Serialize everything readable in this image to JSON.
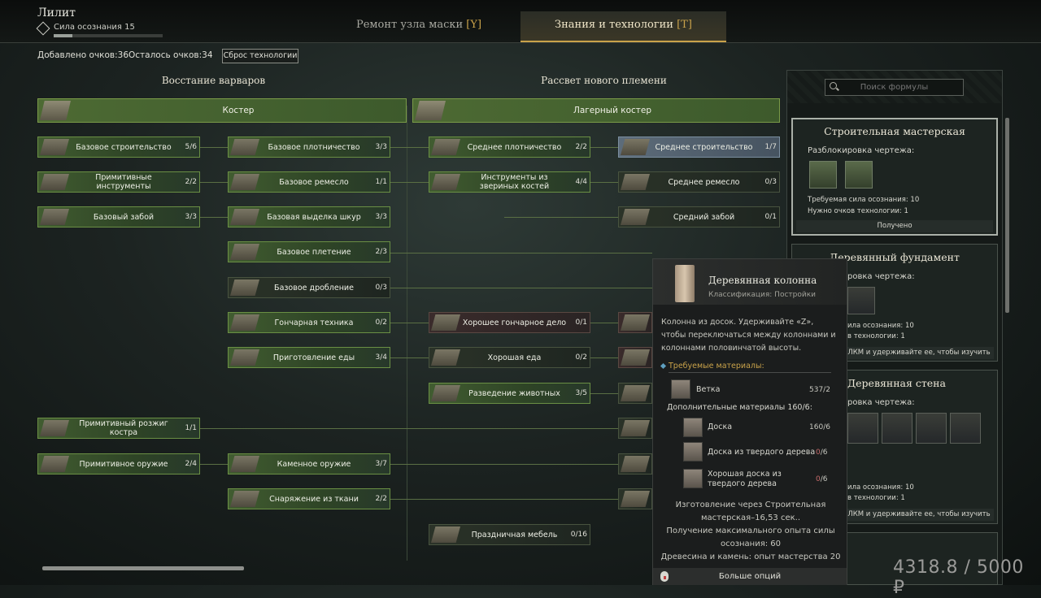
{
  "player": {
    "name": "Лилит",
    "awareness": "Сила осознания 15",
    "awareness_progress": 0.17
  },
  "tabs": [
    {
      "label": "Ремонт узла маски",
      "key": "[Y]",
      "active": false
    },
    {
      "label": "Знания и технологии",
      "key": "[T]",
      "active": true
    }
  ],
  "points": {
    "added": "Добавлено очков:36",
    "left": "Осталось очков:34",
    "reset": "Сброс технологии"
  },
  "columns": {
    "left": "Восстание варваров",
    "right": "Рассвет нового племени"
  },
  "headers": {
    "left": "Костер",
    "right": "Лагерный костер"
  },
  "nodes": [
    {
      "label": "Базовое строительство",
      "count": "5/6"
    },
    {
      "label": "Примитивные инструменты",
      "count": "2/2"
    },
    {
      "label": "Базовый забой",
      "count": "3/3"
    },
    {
      "label": "Базовое плотничество",
      "count": "3/3"
    },
    {
      "label": "Базовое ремесло",
      "count": "1/1"
    },
    {
      "label": "Базовая выделка шкур",
      "count": "3/3"
    },
    {
      "label": "Базовое плетение",
      "count": "2/3"
    },
    {
      "label": "Базовое дробление",
      "count": "0/3"
    },
    {
      "label": "Гончарная техника",
      "count": "0/2"
    },
    {
      "label": "Приготовление еды",
      "count": "3/4"
    },
    {
      "label": "Примитивный розжиг костра",
      "count": "1/1"
    },
    {
      "label": "Примитивное оружие",
      "count": "2/4"
    },
    {
      "label": "Каменное оружие",
      "count": "3/7"
    },
    {
      "label": "Снаряжение из ткани",
      "count": "2/2"
    },
    {
      "label": "Среднее плотничество",
      "count": "2/2"
    },
    {
      "label": "Инструменты из звериных костей",
      "count": "4/4"
    },
    {
      "label": "Хорошее гончарное дело",
      "count": "0/1"
    },
    {
      "label": "Хорошая еда",
      "count": "0/2"
    },
    {
      "label": "Разведение животных",
      "count": "3/5"
    },
    {
      "label": "Праздничная мебель",
      "count": "0/16"
    },
    {
      "label": "Среднее строительство",
      "count": "1/7"
    },
    {
      "label": "Среднее ремесло",
      "count": "0/3"
    },
    {
      "label": "Средний забой",
      "count": "0/1"
    }
  ],
  "search": {
    "placeholder": "Поиск формулы"
  },
  "cards": [
    {
      "title": "Строительная мастерская",
      "unlock": "Разблокировка чертежа:",
      "req_power": "Требуемая сила осознания: 10",
      "req_points": "Нужно очков технологии: 1",
      "footer": "Получено"
    },
    {
      "title": "Деревянный фундамент",
      "unlock": "ровка чертежа:",
      "req_power": "ила осознания: 10",
      "req_points": "в технологии: 1",
      "footer": "ЛКМ и удерживайте ее, чтобы изучить"
    },
    {
      "title": "Деревянная стена",
      "unlock": "ровка чертежа:",
      "req_power": "ила осознания: 10",
      "req_points": "в технологии: 1",
      "footer": "ЛКМ и удерживайте ее, чтобы изучить"
    }
  ],
  "tooltip": {
    "title": "Деревянная колонна",
    "classification": "Классификация: Постройки",
    "description": "Колонна из досок. Удерживайте «Z», чтобы переключаться между колоннами и колоннами половинчатой высоты.",
    "required_label": "Требуемые материалы:",
    "main_material": {
      "name": "Ветка",
      "count": "537/2"
    },
    "extra_label": "Дополнительные материалы 160/6:",
    "extra_materials": [
      {
        "name": "Доска",
        "have": "160",
        "need": "/6"
      },
      {
        "name": "Доска из твердого дерева",
        "have": "0",
        "need": "/6"
      },
      {
        "name": "Хорошая доска из твердого дерева",
        "have": "0",
        "need": "/6"
      }
    ],
    "craft": "Изготовление через Строительная мастерская–16,53 сек..",
    "xp": "Получение максимального опыта силы осознания: 60",
    "mastery": "Древесина и камень: опыт мастерства 20",
    "more": "Больше опций"
  },
  "price": "4318.8 / 5000 ₽"
}
